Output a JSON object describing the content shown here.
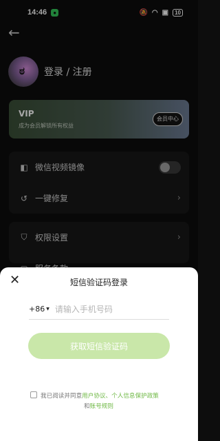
{
  "status_bar": {
    "time": "14:46",
    "battery": "10"
  },
  "profile": {
    "login_label": "登录 / 注册"
  },
  "vip": {
    "title": "VIP",
    "subtitle": "成为会员解锁所有权益",
    "button": "会员中心"
  },
  "menu": [
    {
      "label": "微信视频镜像",
      "icon": "mirror-icon",
      "control": "toggle",
      "toggle_on": false
    },
    {
      "label": "一键修复",
      "icon": "repair-icon",
      "control": "chevron"
    },
    {
      "label": "权限设置",
      "icon": "shield-icon",
      "control": "chevron"
    },
    {
      "label": "服务条款",
      "icon": "document-icon",
      "control": "chevron"
    }
  ],
  "login_sheet": {
    "title": "短信验证码登录",
    "country_code": "+86",
    "phone_placeholder": "请输入手机号码",
    "submit_label": "获取短信验证码",
    "agreement_prefix": "我已阅读并同意",
    "agreement_link1": "用户协议、个人信息保护政策",
    "agreement_and": "和",
    "agreement_link2": "账号规则"
  },
  "colors": {
    "accent": "#6fb845",
    "button_disabled": "#c9e7a9"
  }
}
